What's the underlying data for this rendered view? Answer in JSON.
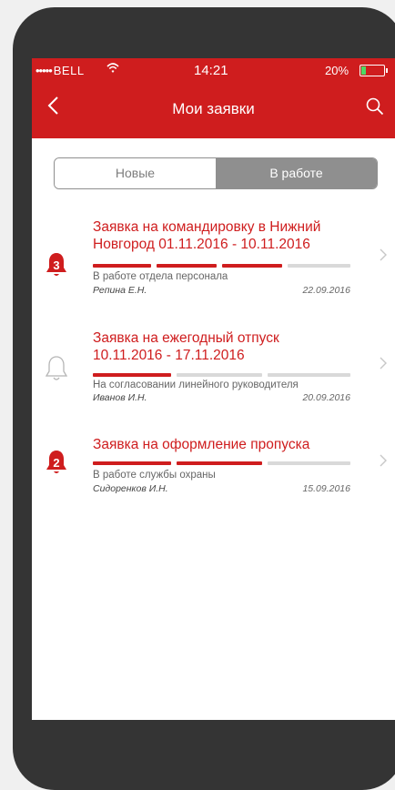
{
  "status_bar": {
    "signal_dots": "•••••",
    "carrier": "BELL",
    "time": "14:21",
    "battery": "20%"
  },
  "nav": {
    "title": "Мои заявки",
    "back_icon": "chevron-left-icon",
    "search_icon": "search-icon"
  },
  "tabs": [
    {
      "label": "Новые",
      "selected": false
    },
    {
      "label": "В работе",
      "selected": true
    }
  ],
  "requests": [
    {
      "title_line1": "Заявка на командировку в Нижний",
      "title_line2": "Новгород 01.11.2016 - 10.11.2016",
      "badge": "3",
      "icon": "bell-icon-filled",
      "progress_done": 3,
      "progress_total": 4,
      "status": "В работе отдела персонала",
      "person": "Репина Е.Н.",
      "date": "22.09.2016"
    },
    {
      "title_line1": "Заявка на ежегодный отпуск",
      "title_line2": "10.11.2016 - 17.11.2016",
      "badge": "",
      "icon": "bell-icon-outline",
      "progress_done": 1,
      "progress_total": 3,
      "status": "На согласовании линейного руководителя",
      "person": "Иванов И.Н.",
      "date": "20.09.2016"
    },
    {
      "title_line1": "Заявка на оформление пропуска",
      "title_line2": "",
      "badge": "2",
      "icon": "bell-icon-filled",
      "progress_done": 2,
      "progress_total": 3,
      "status": "В работе службы охраны",
      "person": "Сидоренков И.Н.",
      "date": "15.09.2016"
    }
  ],
  "colors": {
    "accent": "#cf1d1e",
    "segment_selected": "#8f8f8f",
    "progress_todo": "#d9d9d9"
  }
}
